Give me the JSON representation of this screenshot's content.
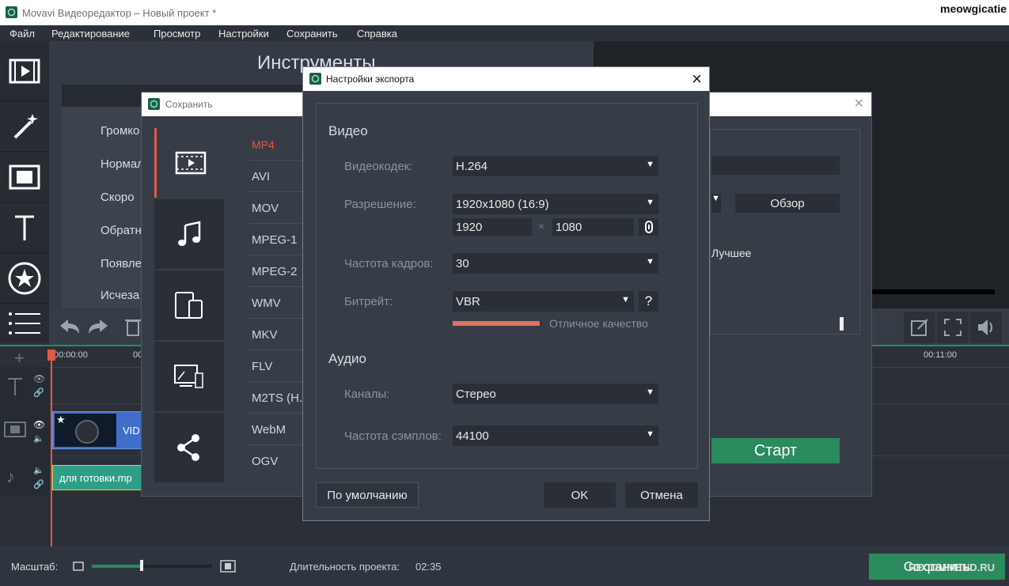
{
  "window": {
    "title": "Movavi Видеоредактор – Новый проект *",
    "user": "meowgicatie"
  },
  "menu": [
    "Файл",
    "Редактирование",
    "Просмотр",
    "Настройки",
    "Сохранить",
    "Справка"
  ],
  "tools": {
    "title": "Инструменты",
    "items": [
      "Громко",
      "Нормал",
      "Скоро",
      "Обратн",
      "Появле",
      "Исчеза"
    ]
  },
  "timeline": {
    "times": [
      "00:00:00",
      "00",
      "00:11:00"
    ],
    "video_clip_label": "VID",
    "audio_clip_label": "для готовки.mp"
  },
  "status": {
    "zoom_label": "Масштаб:",
    "zoom_level": 0.5,
    "duration_label": "Длительность проекта:",
    "duration_value": "02:35",
    "save_button": "Сохранить",
    "watermark": "RECOMMEND.RU"
  },
  "save_dialog": {
    "title": "Сохранить",
    "formats": [
      "MP4",
      "AVI",
      "MOV",
      "MPEG-1",
      "MPEG-2",
      "WMV",
      "MKV",
      "FLV",
      "M2TS (H.",
      "WebM",
      "OGV"
    ],
    "browse_button": "Обзор",
    "quality_label": "Лучшее",
    "start_button": "Старт"
  },
  "export_dialog": {
    "title": "Настройки экспорта",
    "video_heading": "Видео",
    "codec_label": "Видеокодек:",
    "codec_value": "H.264",
    "resolution_label": "Разрешение:",
    "resolution_value": "1920x1080 (16:9)",
    "width_value": "1920",
    "height_value": "1080",
    "times_sign": "×",
    "framerate_label": "Частота кадров:",
    "framerate_value": "30",
    "bitrate_label": "Битрейт:",
    "bitrate_value": "VBR",
    "help": "?",
    "quality_text": "Отличное качество",
    "quality_level": 0.98,
    "audio_heading": "Аудио",
    "channels_label": "Каналы:",
    "channels_value": "Стерео",
    "samplerate_label": "Частота сэмплов:",
    "samplerate_value": "44100",
    "default_button": "По умолчанию",
    "ok_button": "OK",
    "cancel_button": "Отмена"
  },
  "colors": {
    "accent": "#e05a47",
    "green": "#2c8a5f",
    "video_clip": "#3f6fc9",
    "audio_clip": "#2f9e86"
  }
}
